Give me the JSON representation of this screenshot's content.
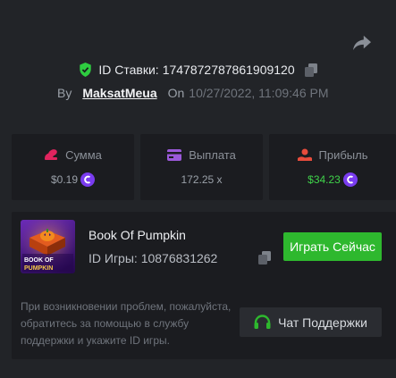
{
  "bet": {
    "id_label": "ID Ставки:",
    "id_value": "1747872787861909120",
    "by_label": "By",
    "user": "MaksatMeua",
    "on_label": "On",
    "datetime": "10/27/2022, 11:09:46 PM"
  },
  "stats": {
    "amount": {
      "label": "Сумма",
      "value": "$0.19"
    },
    "payout": {
      "label": "Выплата",
      "value": "172.25 x"
    },
    "profit": {
      "label": "Прибыль",
      "value": "$34.23"
    }
  },
  "game": {
    "title": "Book Of Pumpkin",
    "id_label": "ID Игры:",
    "id_value": "10876831262",
    "thumb_text_line1": "BOOK OF",
    "thumb_text_line2": "PUMPKIN",
    "play_label": "Играть Сейчас"
  },
  "support": {
    "help_text": "При возникновении проблем, пожалуйста, обратитесь за помощью в службу поддержки и укажите ID игры.",
    "button_label": "Чат Поддержки"
  },
  "colors": {
    "background": "#222428",
    "card": "#1b1c20",
    "accent_green": "#2eb82e",
    "profit_green": "#3fd24a",
    "shield_green": "#2ecc40",
    "coin_purple": "#7a3cf0",
    "amount_icon": "#e0245e",
    "payout_icon": "#9b59d9",
    "profit_icon": "#e74c3c"
  },
  "icons": {
    "share": "share-arrow-icon",
    "shield": "shield-check-icon",
    "copy": "copy-icon",
    "amount": "coins-icon",
    "payout": "wallet-card-icon",
    "profit": "hand-profit-icon",
    "coin": "crypto-coin-icon",
    "headset": "headset-icon"
  }
}
